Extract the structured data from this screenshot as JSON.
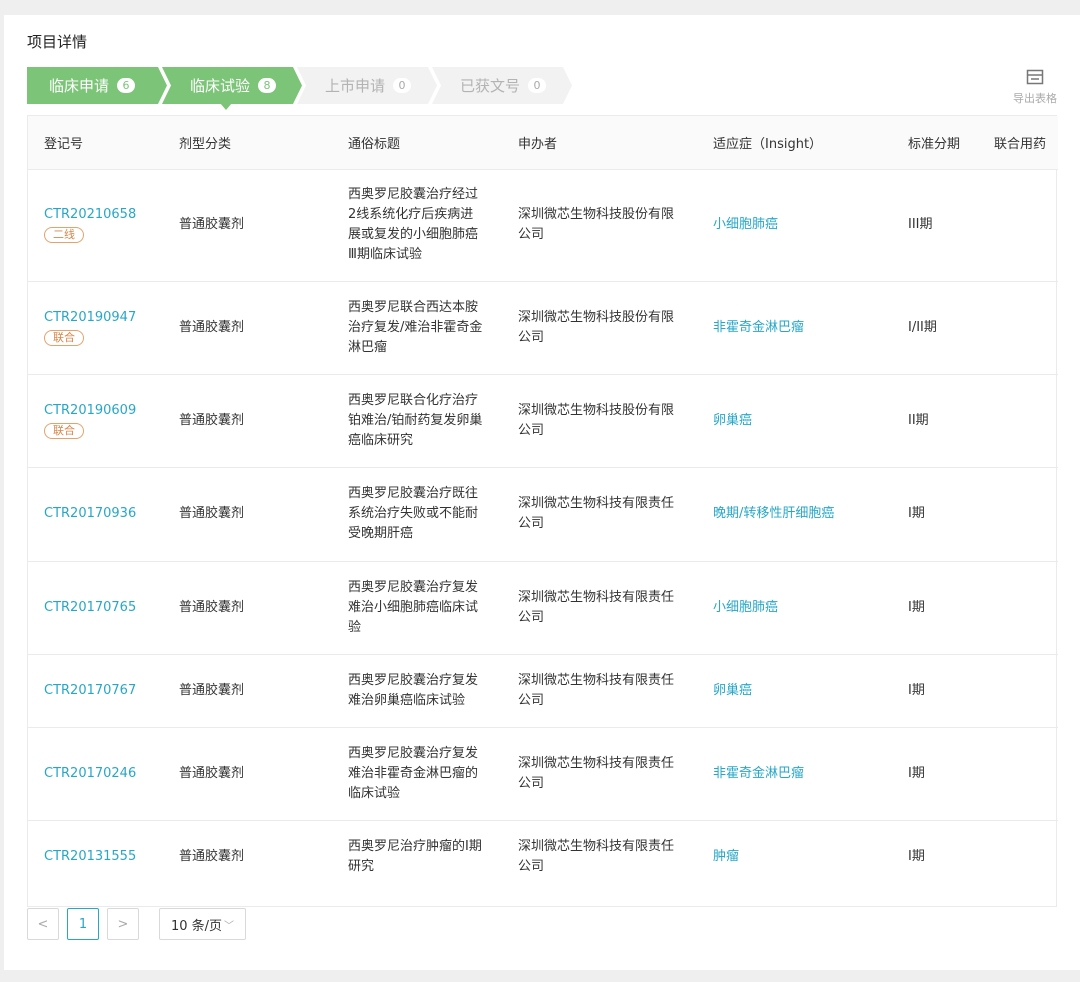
{
  "page": {
    "title": "项目详情"
  },
  "steps": [
    {
      "label": "临床申请",
      "count": "6",
      "active": true
    },
    {
      "label": "临床试验",
      "count": "8",
      "active": true,
      "selected": true
    },
    {
      "label": "上市申请",
      "count": "0",
      "active": false
    },
    {
      "label": "已获文号",
      "count": "0",
      "active": false
    }
  ],
  "export": {
    "label": "导出表格",
    "icon": "export-table-icon"
  },
  "table": {
    "headers": [
      "登记号",
      "剂型分类",
      "通俗标题",
      "申办者",
      "适应症（Insight）",
      "标准分期",
      "联合用药"
    ],
    "rows": [
      {
        "id": "CTR20210658",
        "tag": "二线",
        "form": "普通胶囊剂",
        "title": "西奥罗尼胶囊治疗经过2线系统化疗后疾病进展或复发的小细胞肺癌Ⅲ期临床试验",
        "sponsor": "深圳微芯生物科技股份有限公司",
        "indication": "小细胞肺癌",
        "phase": "III期",
        "combo": ""
      },
      {
        "id": "CTR20190947",
        "tag": "联合",
        "form": "普通胶囊剂",
        "title": "西奥罗尼联合西达本胺治疗复发/难治非霍奇金淋巴瘤",
        "sponsor": "深圳微芯生物科技股份有限公司",
        "indication": "非霍奇金淋巴瘤",
        "phase": "I/II期",
        "combo": ""
      },
      {
        "id": "CTR20190609",
        "tag": "联合",
        "form": "普通胶囊剂",
        "title": "西奥罗尼联合化疗治疗铂难治/铂耐药复发卵巢癌临床研究",
        "sponsor": "深圳微芯生物科技股份有限公司",
        "indication": "卵巢癌",
        "phase": "II期",
        "combo": ""
      },
      {
        "id": "CTR20170936",
        "tag": "",
        "form": "普通胶囊剂",
        "title": "西奥罗尼胶囊治疗既往系统治疗失败或不能耐受晚期肝癌",
        "sponsor": "深圳微芯生物科技有限责任公司",
        "indication": "晚期/转移性肝细胞癌",
        "phase": "I期",
        "combo": ""
      },
      {
        "id": "CTR20170765",
        "tag": "",
        "form": "普通胶囊剂",
        "title": "西奥罗尼胶囊治疗复发难治小细胞肺癌临床试验",
        "sponsor": "深圳微芯生物科技有限责任公司",
        "indication": "小细胞肺癌",
        "phase": "I期",
        "combo": ""
      },
      {
        "id": "CTR20170767",
        "tag": "",
        "form": "普通胶囊剂",
        "title": "西奥罗尼胶囊治疗复发难治卵巢癌临床试验",
        "sponsor": "深圳微芯生物科技有限责任公司",
        "indication": "卵巢癌",
        "phase": "I期",
        "combo": ""
      },
      {
        "id": "CTR20170246",
        "tag": "",
        "form": "普通胶囊剂",
        "title": "西奥罗尼胶囊治疗复发难治非霍奇金淋巴瘤的临床试验",
        "sponsor": "深圳微芯生物科技有限责任公司",
        "indication": "非霍奇金淋巴瘤",
        "phase": "I期",
        "combo": ""
      },
      {
        "id": "CTR20131555",
        "tag": "",
        "form": "普通胶囊剂",
        "title": "西奥罗尼治疗肿瘤的I期研究",
        "sponsor": "深圳微芯生物科技有限责任公司",
        "indication": "肿瘤",
        "phase": "I期",
        "combo": ""
      }
    ]
  },
  "pagination": {
    "prev": "<",
    "current": "1",
    "next": ">",
    "page_size": "10 条/页"
  },
  "colors": {
    "accent_green": "#7cc478",
    "link_blue": "#27a7c8",
    "tag_orange": "#d6874c"
  }
}
